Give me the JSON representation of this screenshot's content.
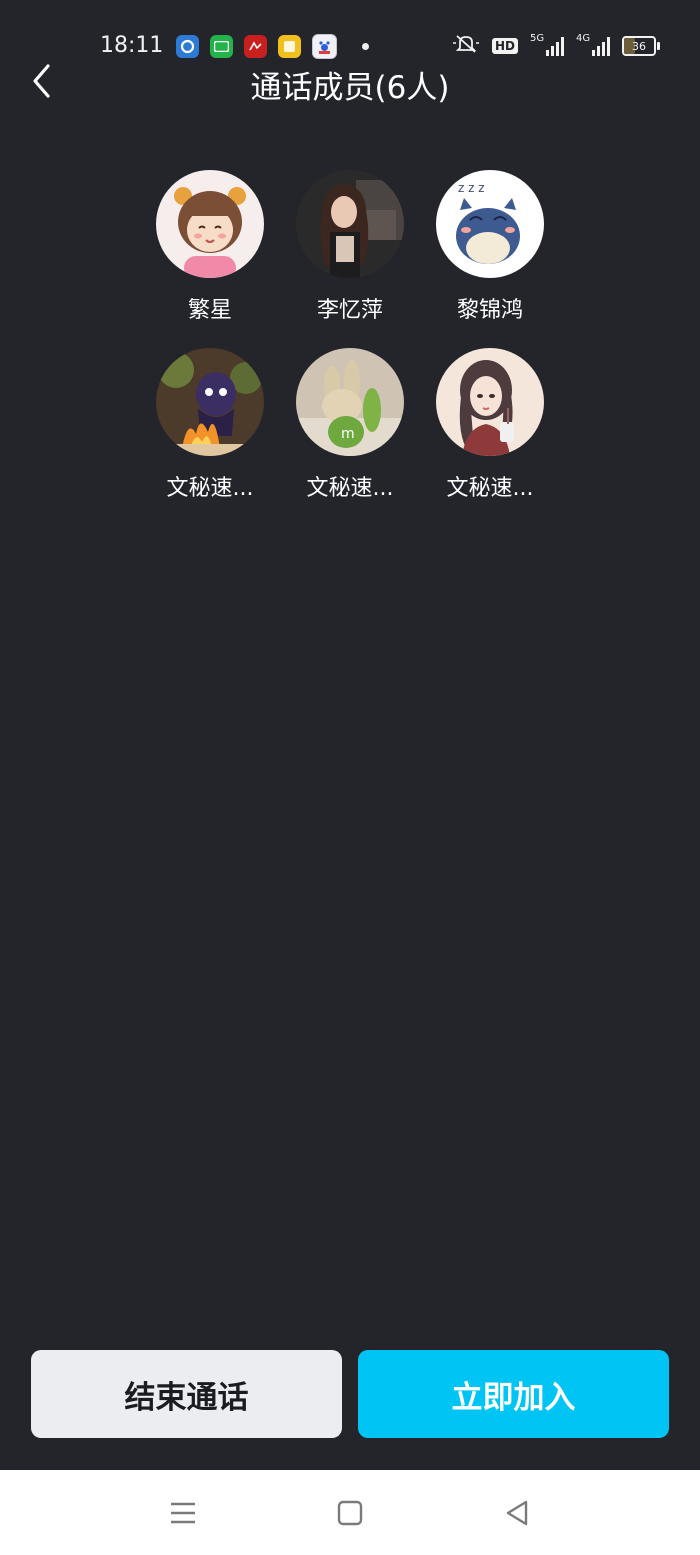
{
  "status_bar": {
    "time": "18:11",
    "hd_label": "HD",
    "signal_1_label": "5G",
    "signal_2_label": "4G",
    "battery_percent": 36,
    "battery_text": "36"
  },
  "header": {
    "title": "通话成员(6人)"
  },
  "members": [
    {
      "name": "繁星"
    },
    {
      "name": "李忆萍"
    },
    {
      "name": "黎锦鸿"
    },
    {
      "name": "文秘速..."
    },
    {
      "name": "文秘速..."
    },
    {
      "name": "文秘速..."
    }
  ],
  "actions": {
    "end_call_label": "结束通话",
    "join_now_label": "立即加入"
  },
  "colors": {
    "background": "#23252b",
    "join_button": "#00c5f4",
    "end_button": "#ecedf1"
  },
  "icons": {
    "back": "chevron-left-icon",
    "nav_menu": "menu-icon",
    "nav_home": "home-square-icon",
    "nav_back": "back-triangle-icon"
  }
}
